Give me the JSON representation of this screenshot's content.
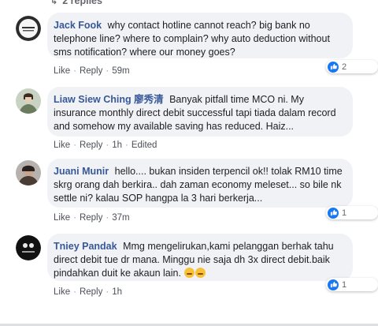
{
  "replies_top": {
    "label": "2 replies"
  },
  "comments": [
    {
      "name": "Jack Fook",
      "text": "why contact hotline cannot reach? big bank no telephone line? where to complain? why auto deduction without sms notification? where our money goes?",
      "actions": {
        "like": "Like",
        "reply": "Reply",
        "time": "59m"
      },
      "reaction_count": "2"
    },
    {
      "name": "Liaw Siew Ching 廖秀清",
      "text": "Banyak pitfall time MCO ni. My insurance monthly direct debit successful tapi tiada dalam record and somehow my available saving has reduced. Haiz...",
      "actions": {
        "like": "Like",
        "reply": "Reply",
        "time": "1h",
        "edited": "Edited"
      }
    },
    {
      "name": "Juani Munir",
      "text": "hello.... bukan insiden terpencil ok!! tolak RM10 time skrg orang dah berkira.. dah zaman economy meleset... so bile nk settle ni? kalau SOP hangpa la 3 hari berkerja...",
      "actions": {
        "like": "Like",
        "reply": "Reply",
        "time": "37m"
      },
      "reaction_count": "1"
    },
    {
      "name": "Tniey Pandak",
      "text": "Mmg mengelirukan,kami pelanggan berhak tahu direct debit tue dr mana. Minggu nie saja dh 3x direct debit.baik pindahkan duit ke akaun lain.",
      "actions": {
        "like": "Like",
        "reply": "Reply",
        "time": "1h"
      },
      "reaction_count": "1"
    }
  ],
  "colors": {
    "name": "#385898",
    "bubble": "#f0f2f5",
    "like_blue": "#1877f2",
    "meta": "#65676b"
  }
}
